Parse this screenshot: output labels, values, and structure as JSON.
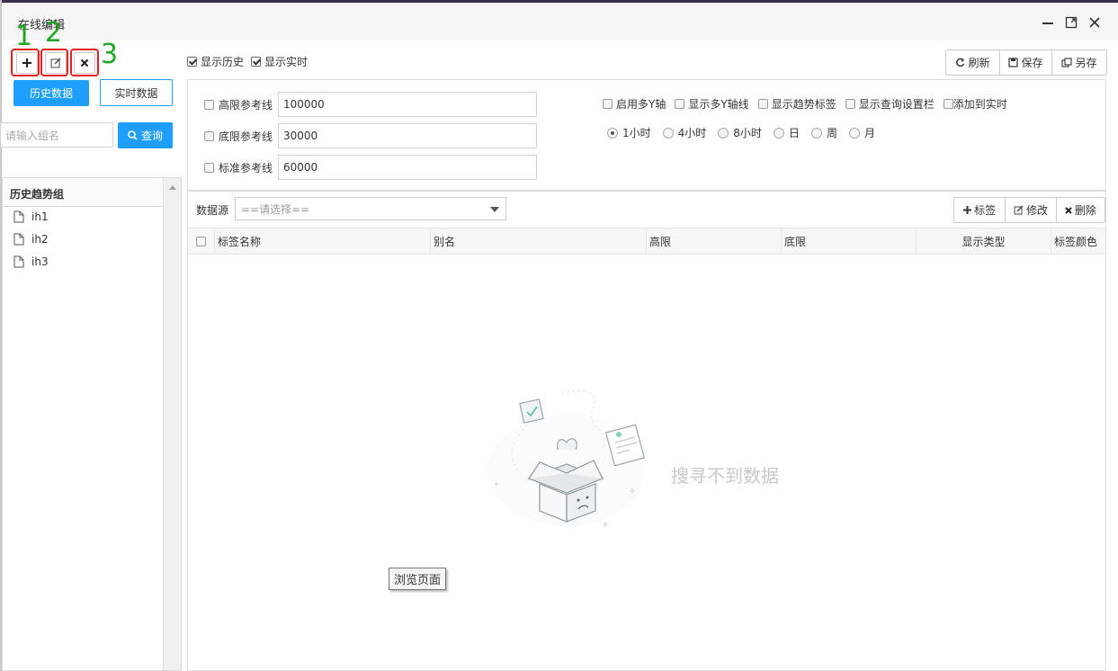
{
  "window": {
    "title": "在线编辑"
  },
  "annotations": [
    "1",
    "2",
    "3"
  ],
  "left": {
    "btn_history": "历史数据",
    "btn_realtime": "实时数据",
    "search_placeholder": "请输入组名",
    "search_button": "查询",
    "tree_header": "历史趋势组",
    "tree_items": [
      "ih1",
      "ih2",
      "ih3"
    ]
  },
  "top": {
    "show_history": "显示历史",
    "show_realtime": "显示实时",
    "refresh": "刷新",
    "save": "保存",
    "save_as": "另存"
  },
  "settings": {
    "high_ref_label": "高限参考线",
    "high_ref_value": "100000",
    "low_ref_label": "底限参考线",
    "low_ref_value": "30000",
    "std_ref_label": "标准参考线",
    "std_ref_value": "60000",
    "opt_multi_y": "启用多Y轴",
    "opt_show_multi_y": "显示多Y轴线",
    "opt_trend_label": "显示趋势标签",
    "opt_query_bar": "显示查询设置栏",
    "opt_add_realtime": "添加到实时",
    "ranges": [
      "1小时",
      "4小时",
      "8小时",
      "日",
      "周",
      "月"
    ]
  },
  "grid": {
    "source_label": "数据源",
    "source_placeholder": "==请选择==",
    "btn_tag": "标签",
    "btn_edit": "修改",
    "btn_delete": "删除",
    "columns": [
      "标签名称",
      "别名",
      "高限",
      "底限",
      "显示类型",
      "标签颜色"
    ],
    "empty_text": "搜寻不到数据"
  },
  "tooltip": "浏览页面",
  "colors": {
    "primary": "#1e9fff",
    "annotation_box": "#e32121",
    "annotation_number": "#21a621"
  }
}
